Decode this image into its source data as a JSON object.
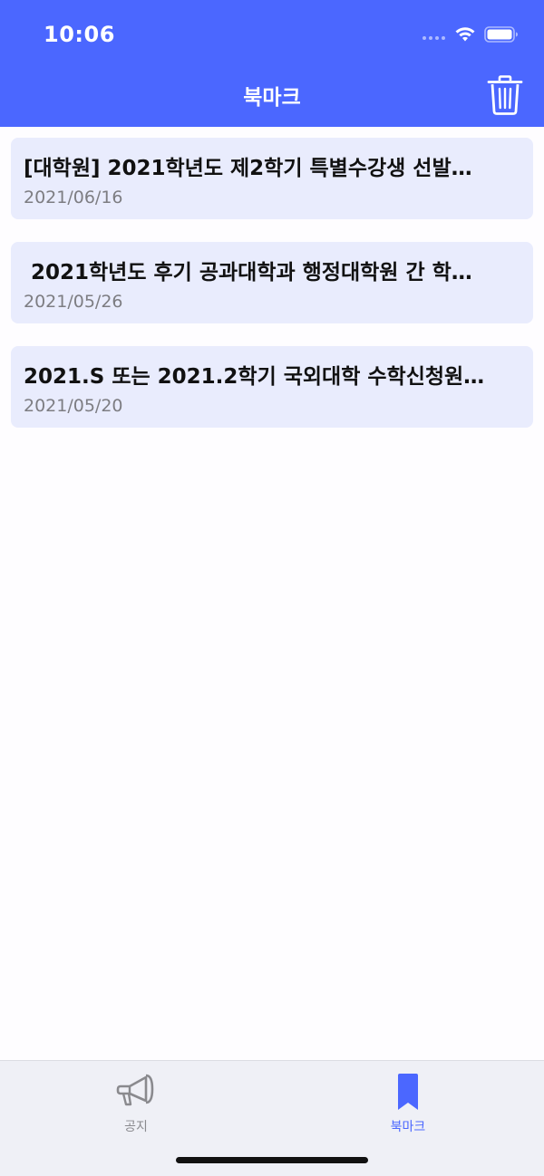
{
  "status_bar": {
    "time": "10:06"
  },
  "header": {
    "title": "북마크",
    "trash_icon": "trash-icon",
    "background_color": "#4b67ff"
  },
  "bookmarks": [
    {
      "title": "[대학원] 2021학년도 제2학기 특별수강생 선발…",
      "date": "2021/06/16"
    },
    {
      "title": " 2021학년도 후기 공과대학과 행정대학원 간 학…",
      "date": "2021/05/26"
    },
    {
      "title": "2021.S 또는 2021.2학기 국외대학 수학신청원…",
      "date": "2021/05/20"
    }
  ],
  "tab_bar": {
    "tabs": [
      {
        "label": "공지",
        "icon": "megaphone-icon",
        "selected": false
      },
      {
        "label": "북마크",
        "icon": "bookmark-icon",
        "selected": true
      }
    ],
    "active_color": "#4b67ff",
    "inactive_color": "#8a8a8e"
  }
}
